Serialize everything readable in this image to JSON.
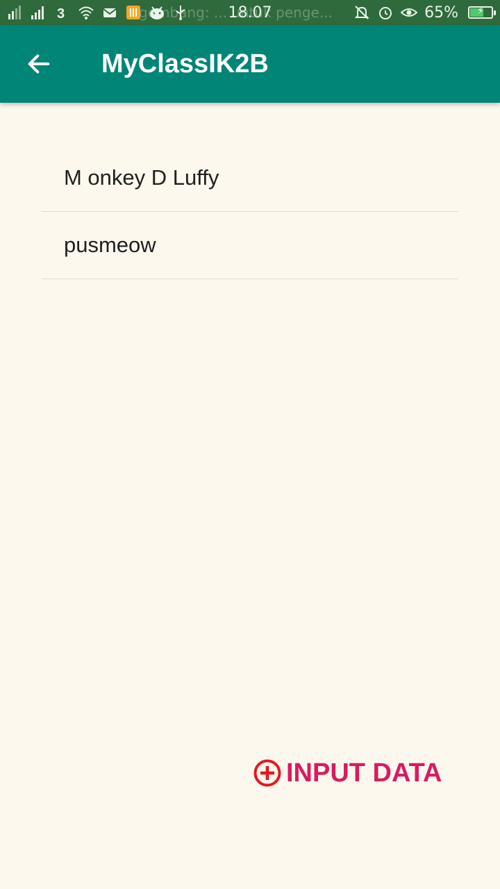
{
  "status_bar": {
    "time": "18.07",
    "battery_percent": "65%",
    "battery_level": 0.65,
    "ticker_text": "gembang: ... untuk penge..."
  },
  "app_bar": {
    "title": "MyClassIK2B",
    "back_icon": "arrow-left-icon"
  },
  "list": {
    "items": [
      {
        "label": "M onkey D Luffy"
      },
      {
        "label": "pusmeow"
      }
    ]
  },
  "input_button": {
    "label": "INPUT DATA",
    "icon": "plus-circle-icon",
    "icon_color": "#e8161f",
    "text_color": "#d81b60"
  },
  "colors": {
    "status_bar": "#2f6a3c",
    "app_bar": "#008577",
    "background": "#fdf8ee"
  }
}
